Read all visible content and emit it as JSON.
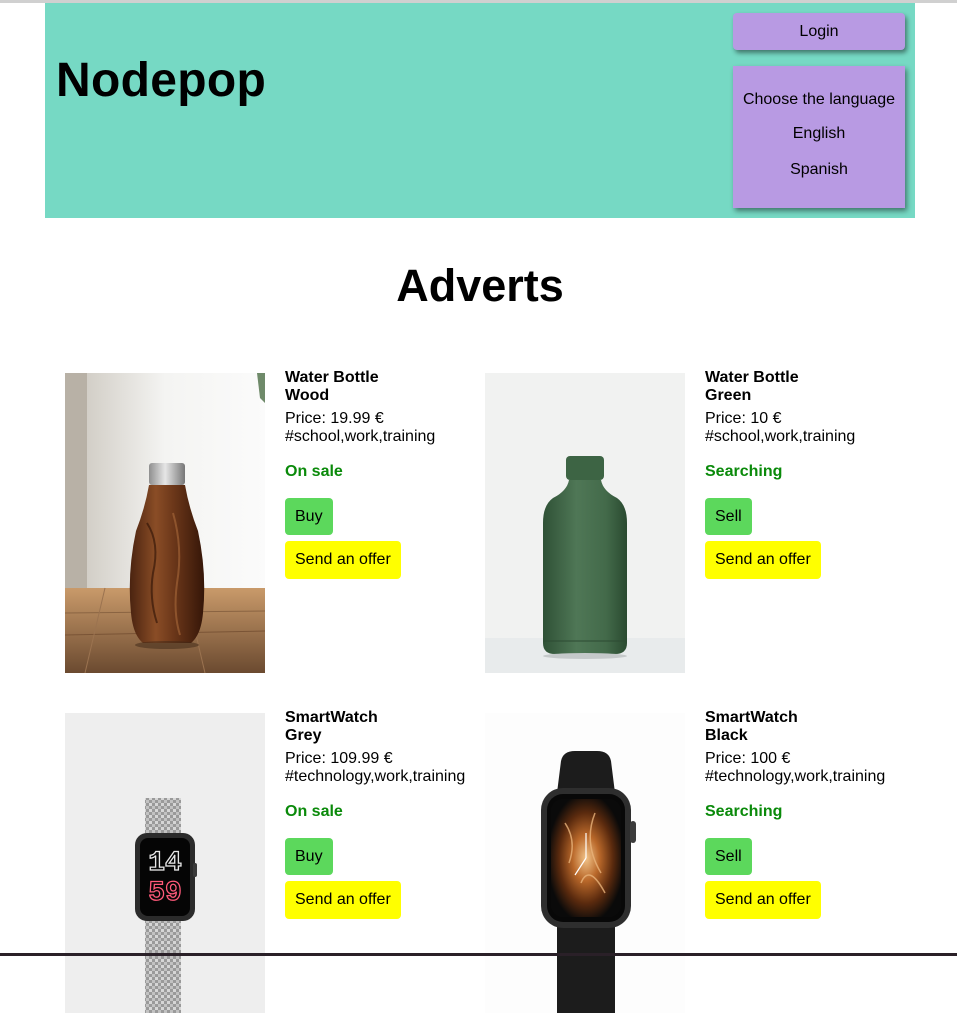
{
  "header": {
    "brand": "Nodepop",
    "login_label": "Login",
    "language": {
      "title": "Choose the language",
      "options": [
        "English",
        "Spanish"
      ]
    }
  },
  "page_title": "Adverts",
  "colors": {
    "header_bg": "#76d9c4",
    "menu_bg": "#b89ae3",
    "status_green": "#0a8a0a",
    "action_green": "#5cd85c",
    "offer_yellow": "#ffff00"
  },
  "adverts": [
    {
      "name_line1": "Water Bottle",
      "name_line2": "Wood",
      "price": "Price: 19.99 €",
      "tags": "#school,work,training",
      "status": "On sale",
      "action": "Buy",
      "offer": "Send an offer",
      "image": "wooden-water-bottle-photo"
    },
    {
      "name_line1": "Water Bottle",
      "name_line2": "Green",
      "price": "Price: 10 €",
      "tags": "#school,work,training",
      "status": "Searching",
      "action": "Sell",
      "offer": "Send an offer",
      "image": "green-water-bottle-photo"
    },
    {
      "name_line1": "SmartWatch",
      "name_line2": "Grey",
      "price": "Price: 109.99 €",
      "tags": "#technology,work,training",
      "status": "On sale",
      "action": "Buy",
      "offer": "Send an offer",
      "image": "grey-smartwatch-photo",
      "watch_face": {
        "hour": "14",
        "minute": "59"
      }
    },
    {
      "name_line1": "SmartWatch",
      "name_line2": "Black",
      "price": "Price: 100 €",
      "tags": "#technology,work,training",
      "status": "Searching",
      "action": "Sell",
      "offer": "Send an offer",
      "image": "black-smartwatch-photo"
    }
  ]
}
